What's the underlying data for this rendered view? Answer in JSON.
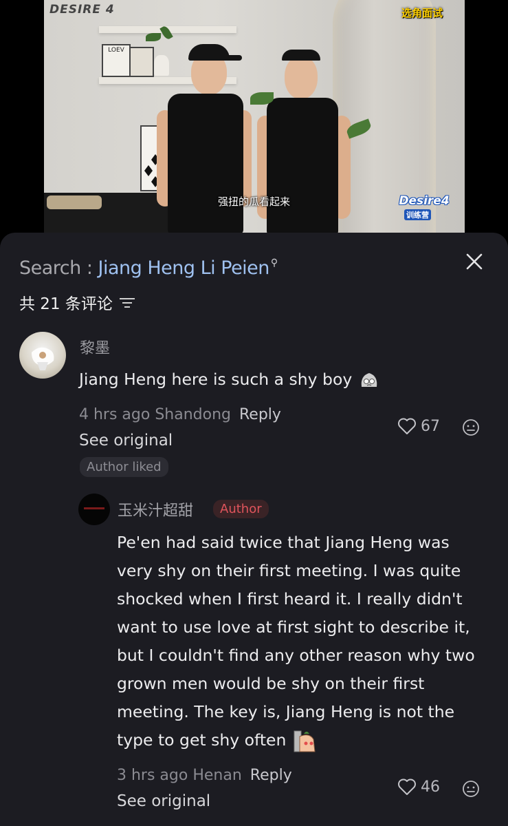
{
  "video": {
    "brand_text": "DESIRE 4",
    "corner_tag": "选角面试",
    "subtitle": "强扭的瓜看起来",
    "logo_text": "Desire4",
    "logo_sub": "训练营",
    "poster_text": "LOEV"
  },
  "search": {
    "label": "Search : ",
    "term": "Jiang Heng Li Peien",
    "close_icon": "close-icon"
  },
  "comments_count": "共 21 条评论",
  "comments": [
    {
      "name": "黎墨",
      "text": "Jiang Heng here is such a shy boy",
      "time_location": "4 hrs ago Shandong",
      "reply_label": "Reply",
      "see_original": "See original",
      "author_liked": "Author liked",
      "likes": "67"
    }
  ],
  "replies": [
    {
      "name": "玉米汁超甜",
      "badge": "Author",
      "text_lines": [
        "Pe'en had said twice that Jiang Heng was",
        "very shy on their first meeting. I was quite",
        "shocked when I first heard it. I really didn't",
        "want to use love at first sight to describe it,",
        "but I couldn't find any other reason why two",
        "grown men would be shy on their first",
        "meeting. The key is, Jiang Heng is not the",
        "type to get shy often"
      ],
      "time_location": "3 hrs ago Henan",
      "reply_label": "Reply",
      "see_original": "See original",
      "likes": "46"
    }
  ],
  "colors": {
    "sheet_bg": "#1c1c22",
    "search_term": "#9fc1f0",
    "author_badge": "#e0545c"
  }
}
